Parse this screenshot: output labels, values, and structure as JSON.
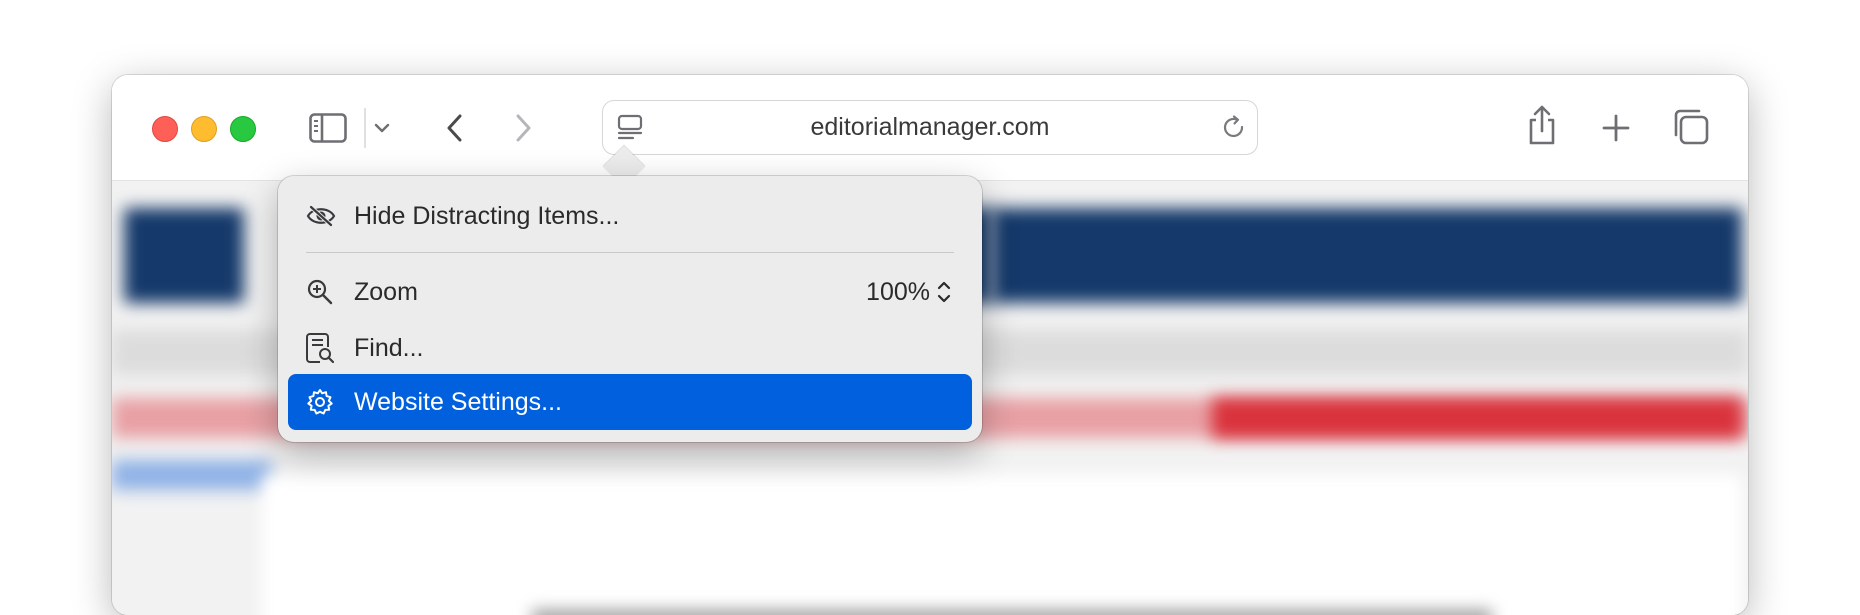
{
  "browser": {
    "address": "editorialmanager.com"
  },
  "menu": {
    "hide_distracting": "Hide Distracting Items...",
    "zoom_label": "Zoom",
    "zoom_value": "100%",
    "find_label": "Find...",
    "website_settings": "Website Settings..."
  },
  "colors": {
    "selection": "#0160dd",
    "page_header": "#15396a",
    "page_banner": "#d9323c"
  },
  "icons": {
    "sidebar": "sidebar-icon",
    "chevron": "chevron-down-icon",
    "back": "back-icon",
    "forward": "forward-icon",
    "page_menu": "page-menu-icon",
    "reload": "reload-icon",
    "share": "share-icon",
    "new_tab": "plus-icon",
    "tabs": "tab-overview-icon",
    "hide": "eye-slash-icon",
    "zoom": "zoom-icon",
    "find": "find-icon",
    "settings": "gear-icon"
  }
}
